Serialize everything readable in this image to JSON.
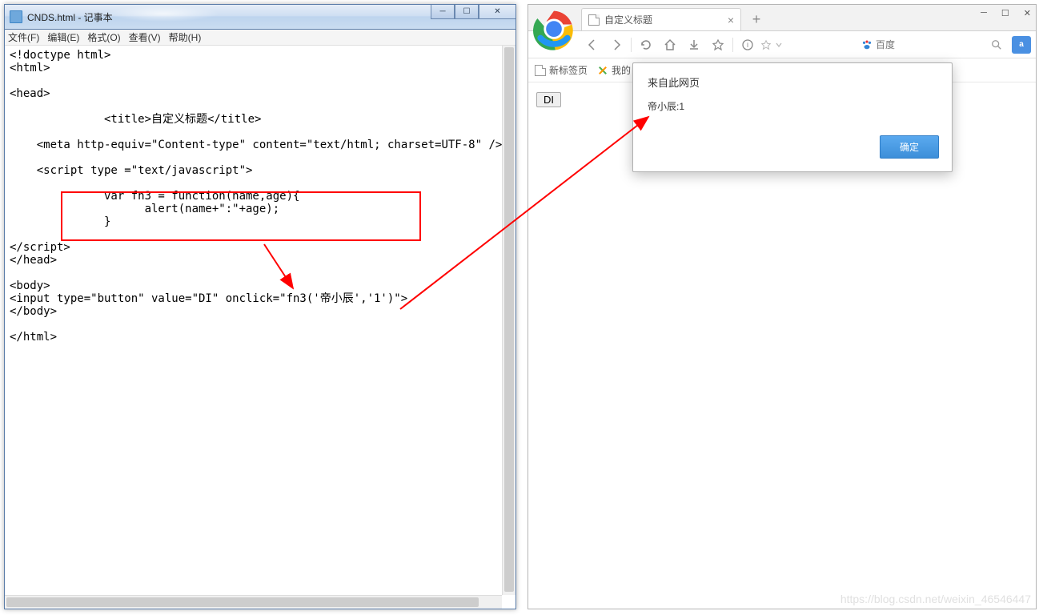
{
  "notepad": {
    "title": "CNDS.html - 记事本",
    "menu": {
      "file": "文件(F)",
      "edit": "编辑(E)",
      "format": "格式(O)",
      "view": "查看(V)",
      "help": "帮助(H)"
    },
    "code": "<!doctype html>\n<html>\n\n<head>\n\n              <title>自定义标题</title>\n\n    <meta http-equiv=\"Content-type\" content=\"text/html; charset=UTF-8\" />\n\n    <script type =\"text/javascript\">\n\n              var fn3 = function(name,age){\n                    alert(name+\":\"+age);\n              }\n\n</script>\n</head>\n\n<body>\n<input type=\"button\" value=\"DI\" onclick=\"fn3('帝小辰','1')\">\n</body>\n\n</html>"
  },
  "browser": {
    "tab_title": "自定义标题",
    "newtab_plus": "+",
    "search_placeholder": "百度",
    "bookmarks": {
      "item1": "新标签页",
      "item2": "我的"
    },
    "page_button_value": "DI"
  },
  "alert": {
    "header": "来自此网页",
    "message": "帝小辰:1",
    "ok": "确定"
  },
  "watermark": "https://blog.csdn.net/weixin_46546447"
}
